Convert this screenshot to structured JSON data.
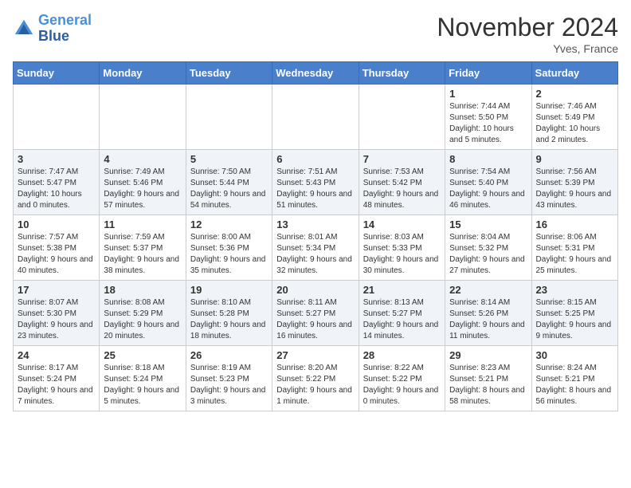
{
  "header": {
    "logo_line1": "General",
    "logo_line2": "Blue",
    "month": "November 2024",
    "location": "Yves, France"
  },
  "days_of_week": [
    "Sunday",
    "Monday",
    "Tuesday",
    "Wednesday",
    "Thursday",
    "Friday",
    "Saturday"
  ],
  "weeks": [
    [
      {
        "day": "",
        "content": ""
      },
      {
        "day": "",
        "content": ""
      },
      {
        "day": "",
        "content": ""
      },
      {
        "day": "",
        "content": ""
      },
      {
        "day": "",
        "content": ""
      },
      {
        "day": "1",
        "content": "Sunrise: 7:44 AM\nSunset: 5:50 PM\nDaylight: 10 hours and 5 minutes."
      },
      {
        "day": "2",
        "content": "Sunrise: 7:46 AM\nSunset: 5:49 PM\nDaylight: 10 hours and 2 minutes."
      }
    ],
    [
      {
        "day": "3",
        "content": "Sunrise: 7:47 AM\nSunset: 5:47 PM\nDaylight: 10 hours and 0 minutes."
      },
      {
        "day": "4",
        "content": "Sunrise: 7:49 AM\nSunset: 5:46 PM\nDaylight: 9 hours and 57 minutes."
      },
      {
        "day": "5",
        "content": "Sunrise: 7:50 AM\nSunset: 5:44 PM\nDaylight: 9 hours and 54 minutes."
      },
      {
        "day": "6",
        "content": "Sunrise: 7:51 AM\nSunset: 5:43 PM\nDaylight: 9 hours and 51 minutes."
      },
      {
        "day": "7",
        "content": "Sunrise: 7:53 AM\nSunset: 5:42 PM\nDaylight: 9 hours and 48 minutes."
      },
      {
        "day": "8",
        "content": "Sunrise: 7:54 AM\nSunset: 5:40 PM\nDaylight: 9 hours and 46 minutes."
      },
      {
        "day": "9",
        "content": "Sunrise: 7:56 AM\nSunset: 5:39 PM\nDaylight: 9 hours and 43 minutes."
      }
    ],
    [
      {
        "day": "10",
        "content": "Sunrise: 7:57 AM\nSunset: 5:38 PM\nDaylight: 9 hours and 40 minutes."
      },
      {
        "day": "11",
        "content": "Sunrise: 7:59 AM\nSunset: 5:37 PM\nDaylight: 9 hours and 38 minutes."
      },
      {
        "day": "12",
        "content": "Sunrise: 8:00 AM\nSunset: 5:36 PM\nDaylight: 9 hours and 35 minutes."
      },
      {
        "day": "13",
        "content": "Sunrise: 8:01 AM\nSunset: 5:34 PM\nDaylight: 9 hours and 32 minutes."
      },
      {
        "day": "14",
        "content": "Sunrise: 8:03 AM\nSunset: 5:33 PM\nDaylight: 9 hours and 30 minutes."
      },
      {
        "day": "15",
        "content": "Sunrise: 8:04 AM\nSunset: 5:32 PM\nDaylight: 9 hours and 27 minutes."
      },
      {
        "day": "16",
        "content": "Sunrise: 8:06 AM\nSunset: 5:31 PM\nDaylight: 9 hours and 25 minutes."
      }
    ],
    [
      {
        "day": "17",
        "content": "Sunrise: 8:07 AM\nSunset: 5:30 PM\nDaylight: 9 hours and 23 minutes."
      },
      {
        "day": "18",
        "content": "Sunrise: 8:08 AM\nSunset: 5:29 PM\nDaylight: 9 hours and 20 minutes."
      },
      {
        "day": "19",
        "content": "Sunrise: 8:10 AM\nSunset: 5:28 PM\nDaylight: 9 hours and 18 minutes."
      },
      {
        "day": "20",
        "content": "Sunrise: 8:11 AM\nSunset: 5:27 PM\nDaylight: 9 hours and 16 minutes."
      },
      {
        "day": "21",
        "content": "Sunrise: 8:13 AM\nSunset: 5:27 PM\nDaylight: 9 hours and 14 minutes."
      },
      {
        "day": "22",
        "content": "Sunrise: 8:14 AM\nSunset: 5:26 PM\nDaylight: 9 hours and 11 minutes."
      },
      {
        "day": "23",
        "content": "Sunrise: 8:15 AM\nSunset: 5:25 PM\nDaylight: 9 hours and 9 minutes."
      }
    ],
    [
      {
        "day": "24",
        "content": "Sunrise: 8:17 AM\nSunset: 5:24 PM\nDaylight: 9 hours and 7 minutes."
      },
      {
        "day": "25",
        "content": "Sunrise: 8:18 AM\nSunset: 5:24 PM\nDaylight: 9 hours and 5 minutes."
      },
      {
        "day": "26",
        "content": "Sunrise: 8:19 AM\nSunset: 5:23 PM\nDaylight: 9 hours and 3 minutes."
      },
      {
        "day": "27",
        "content": "Sunrise: 8:20 AM\nSunset: 5:22 PM\nDaylight: 9 hours and 1 minute."
      },
      {
        "day": "28",
        "content": "Sunrise: 8:22 AM\nSunset: 5:22 PM\nDaylight: 9 hours and 0 minutes."
      },
      {
        "day": "29",
        "content": "Sunrise: 8:23 AM\nSunset: 5:21 PM\nDaylight: 8 hours and 58 minutes."
      },
      {
        "day": "30",
        "content": "Sunrise: 8:24 AM\nSunset: 5:21 PM\nDaylight: 8 hours and 56 minutes."
      }
    ]
  ]
}
